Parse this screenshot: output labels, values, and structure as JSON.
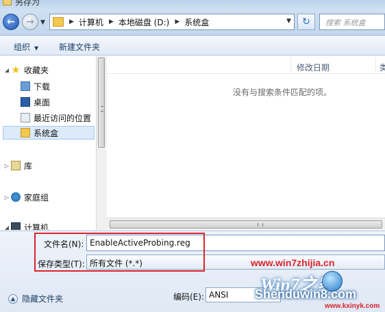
{
  "window": {
    "title": "另存为"
  },
  "address_bar": {
    "breadcrumbs": [
      "计算机",
      "本地磁盘 (D:)",
      "系统盒"
    ]
  },
  "search": {
    "placeholder": "搜索 系统盒"
  },
  "toolbar": {
    "organize_label": "组织",
    "new_folder_label": "新建文件夹"
  },
  "nav_pane": {
    "favorites": {
      "label": "收藏夹",
      "items": [
        "下载",
        "桌面",
        "最近访问的位置",
        "系统盒"
      ]
    },
    "selected_item": "系统盒",
    "libraries_label": "库",
    "homegroup_label": "家庭组",
    "computer_label": "计算机"
  },
  "file_list": {
    "columns": [
      "修改日期",
      "类"
    ],
    "empty_message": "没有与搜索条件匹配的项。"
  },
  "form": {
    "filename_label": "文件名(N):",
    "filename_value": "EnableActiveProbing.reg",
    "filetype_label": "保存类型(T):",
    "filetype_value": "所有文件  (*.*)",
    "encoding_label": "编码(E):",
    "encoding_value": "ANSI",
    "hide_folders_label": "隐藏文件夹"
  },
  "watermark": {
    "url": "www.win7zhijia.cn",
    "logo": "Win7之家",
    "brand": "Shenduwin8.com",
    "site": "www.kxinyk.com"
  },
  "colors": {
    "highlight_box": "#d8232a",
    "selection": "#dceaf9",
    "accent": "#1e56b0"
  }
}
